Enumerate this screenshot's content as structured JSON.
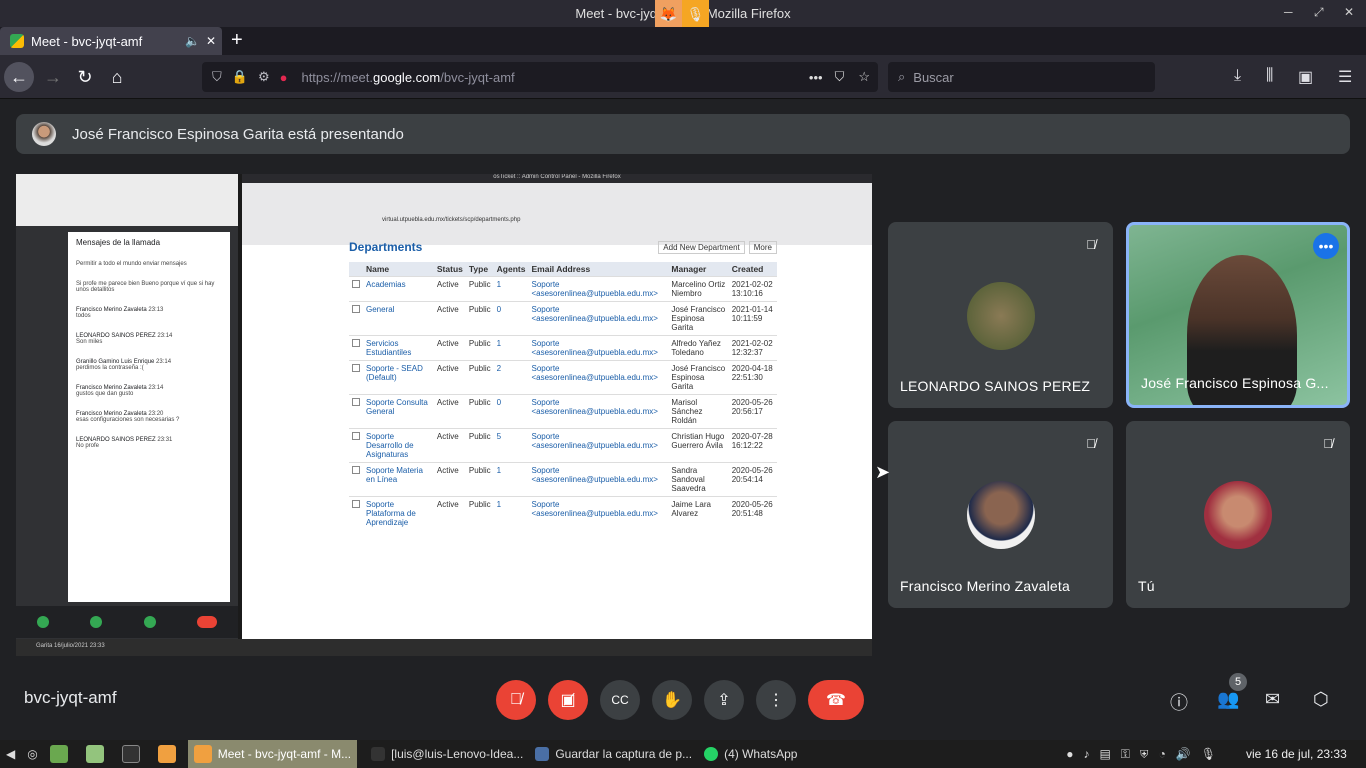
{
  "window": {
    "title": "Meet - bvc-jyqt-amf — Mozilla Firefox"
  },
  "tab": {
    "title": "Meet - bvc-jyqt-amf",
    "audio_icon": "speaker-icon",
    "close": "✕",
    "new": "+"
  },
  "nav": {
    "url_prefix": "https://meet.",
    "url_domain": "google.com",
    "url_path": "/bvc-jyqt-amf",
    "search_placeholder": "Buscar",
    "page_actions": "•••"
  },
  "banner": {
    "text": "José Francisco Espinosa Garita está presentando"
  },
  "presentation": {
    "chat_title": "Mensajes de la llamada",
    "chat_toggle": "Permitir a todo el mundo enviar mensajes",
    "messages": [
      {
        "text": "Si profe me parece bien Bueno porque ví que si hay unos detallitos"
      },
      {
        "from": "Francisco Merino Zavaleta",
        "time": "23:13",
        "text": "todos"
      },
      {
        "from": "LEONARDO SAINOS PEREZ",
        "time": "23:14",
        "text": "Son miles"
      },
      {
        "from": "Granillo Gamino Luis Enrique",
        "time": "23:14",
        "text": "perdimos la contraseña :("
      },
      {
        "from": "Francisco Merino Zavaleta",
        "time": "23:14",
        "text": "gustos que dan gusto"
      },
      {
        "from": "Francisco Merino Zavaleta",
        "time": "23:20",
        "text": "esas configuraciones son necesarias ?"
      },
      {
        "from": "LEONARDO SAINOS PEREZ",
        "time": "23:31",
        "text": "No profe"
      }
    ],
    "inner_window_title": "osTicket :: Admin Control Panel - Mozilla Firefox",
    "inner_url": "virtual.utpuebla.edu.mx/tickets/scp/departments.php",
    "dept_title": "Departments",
    "add_button": "Add New Department",
    "more_button": "More",
    "headers": [
      "Name",
      "Status",
      "Type",
      "Agents",
      "Email Address",
      "Manager",
      "Created"
    ],
    "rows": [
      [
        "Academias",
        "Active",
        "Public",
        "1",
        "Soporte <asesorenlinea@utpuebla.edu.mx>",
        "Marcelino Ortiz Niembro",
        "2021-02-02 13:10:16"
      ],
      [
        "General",
        "Active",
        "Public",
        "0",
        "Soporte <asesorenlinea@utpuebla.edu.mx>",
        "José Francisco Espinosa Garita",
        "2021-01-14 10:11:59"
      ],
      [
        "Servicios Estudiantiles",
        "Active",
        "Public",
        "1",
        "Soporte <asesorenlinea@utpuebla.edu.mx>",
        "Alfredo Yañez Toledano",
        "2021-02-02 12:32:37"
      ],
      [
        "Soporte - SEAD (Default)",
        "Active",
        "Public",
        "2",
        "Soporte <asesorenlinea@utpuebla.edu.mx>",
        "José Francisco Espinosa Garita",
        "2020-04-18 22:51:30"
      ],
      [
        "Soporte Consulta General",
        "Active",
        "Public",
        "0",
        "Soporte <asesorenlinea@utpuebla.edu.mx>",
        "Marisol Sánchez Roldán",
        "2020-05-26 20:56:17"
      ],
      [
        "Soporte Desarrollo de Asignaturas",
        "Active",
        "Public",
        "5",
        "Soporte <asesorenlinea@utpuebla.edu.mx>",
        "Christian Hugo Guerrero Ávila",
        "2020-07-28 16:12:22"
      ],
      [
        "Soporte Materia en Línea",
        "Active",
        "Public",
        "1",
        "Soporte <asesorenlinea@utpuebla.edu.mx>",
        "Sandra Sandoval Saavedra",
        "2020-05-26 20:54:14"
      ],
      [
        "Soporte Plataforma de Aprendizaje",
        "Active",
        "Public",
        "1",
        "Soporte <asesorenlinea@utpuebla.edu.mx>",
        "Jaime Lara Alvarez",
        "2020-05-26 20:51:48"
      ]
    ],
    "inner_taskbar": "Garita 16/julio/2021 23:33"
  },
  "participants": [
    {
      "name": "LEONARDO SAINOS PEREZ"
    },
    {
      "name": "José Francisco Espinosa G..."
    },
    {
      "name": "Francisco Merino Zavaleta"
    },
    {
      "name": "Tú"
    }
  ],
  "bottom": {
    "meeting_code": "bvc-jyqt-amf",
    "participants_count": "5"
  },
  "os_taskbar": {
    "tasks": [
      "Meet - bvc-jyqt-amf - M...",
      "[luis@luis-Lenovo-Idea...",
      "Guardar la captura de p...",
      "(4) WhatsApp"
    ],
    "clock": "vie 16 de jul, 23:33"
  },
  "colors": {
    "accent": "#1a73e8",
    "danger": "#ea4335",
    "tile": "#3c4043",
    "bg": "#202124"
  }
}
